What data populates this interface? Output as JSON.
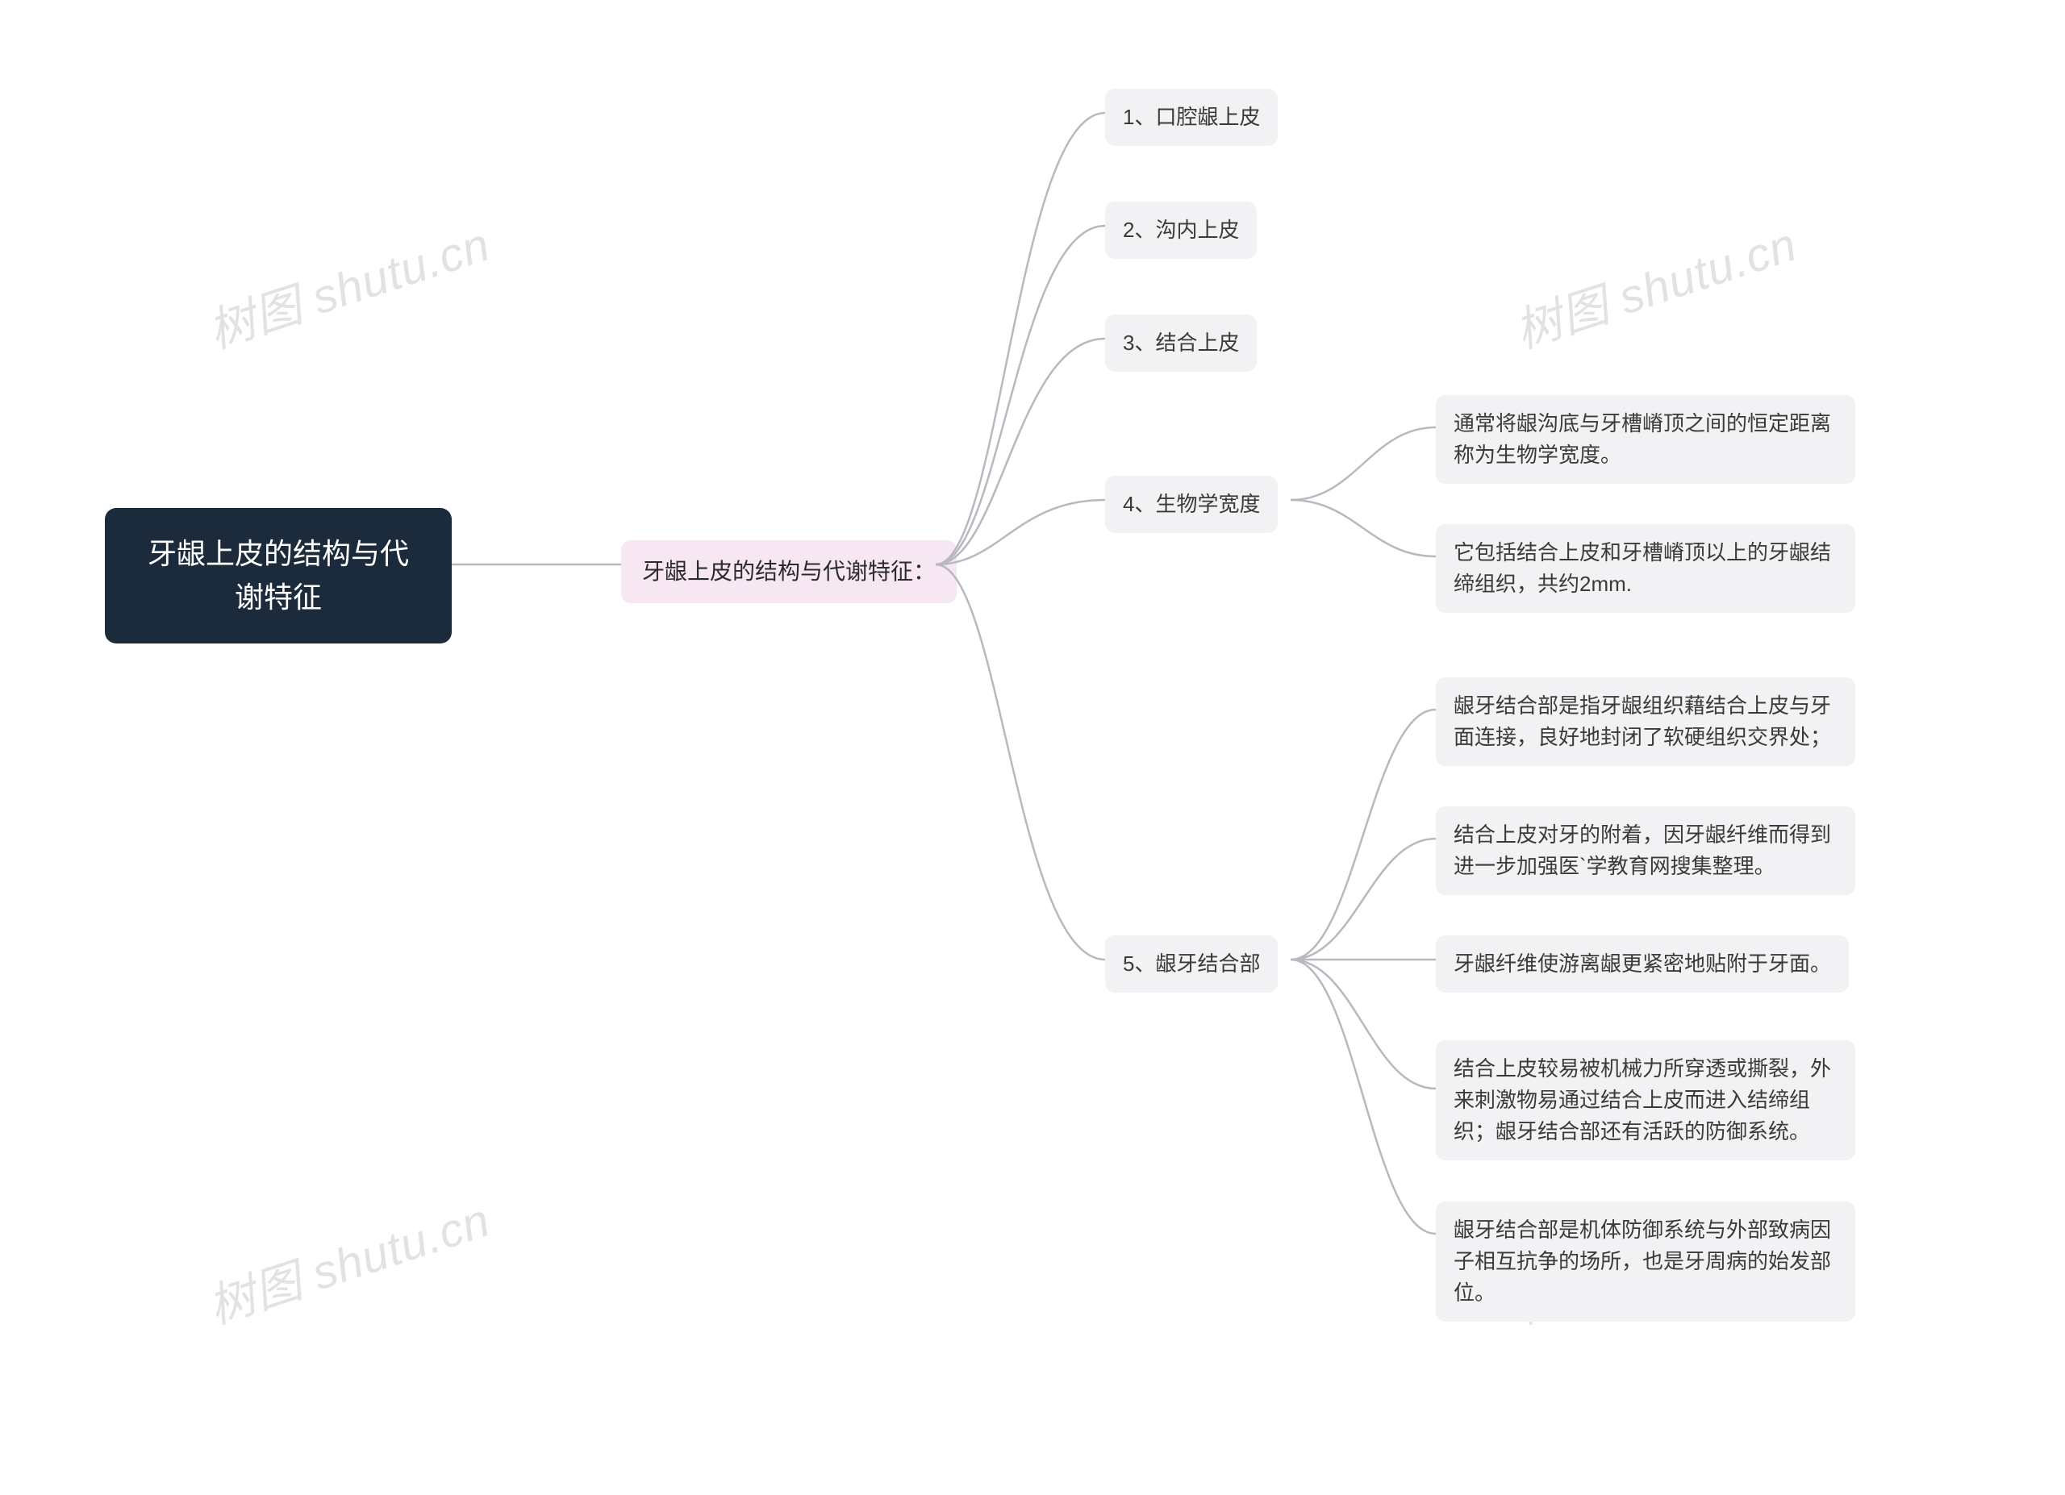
{
  "watermark": "树图 shutu.cn",
  "root": {
    "title": "牙龈上皮的结构与代谢特征"
  },
  "sub": {
    "title": "牙龈上皮的结构与代谢特征："
  },
  "items": {
    "i1": "1、口腔龈上皮",
    "i2": "2、沟内上皮",
    "i3": "3、结合上皮",
    "i4": "4、生物学宽度",
    "i5": "5、龈牙结合部"
  },
  "bioWidth": {
    "d1": "通常将龈沟底与牙槽嵴顶之间的恒定距离称为生物学宽度。",
    "d2": "它包括结合上皮和牙槽嵴顶以上的牙龈结缔组织，共约2mm."
  },
  "junction": {
    "d1": "龈牙结合部是指牙龈组织藉结合上皮与牙面连接，良好地封闭了软硬组织交界处；",
    "d2": "结合上皮对牙的附着，因牙龈纤维而得到进一步加强医`学教育网搜集整理。",
    "d3": "牙龈纤维使游离龈更紧密地贴附于牙面。",
    "d4": "结合上皮较易被机械力所穿透或撕裂，外来刺激物易通过结合上皮而进入结缔组织；龈牙结合部还有活跃的防御系统。",
    "d5": "龈牙结合部是机体防御系统与外部致病因子相互抗争的场所，也是牙周病的始发部位。"
  }
}
